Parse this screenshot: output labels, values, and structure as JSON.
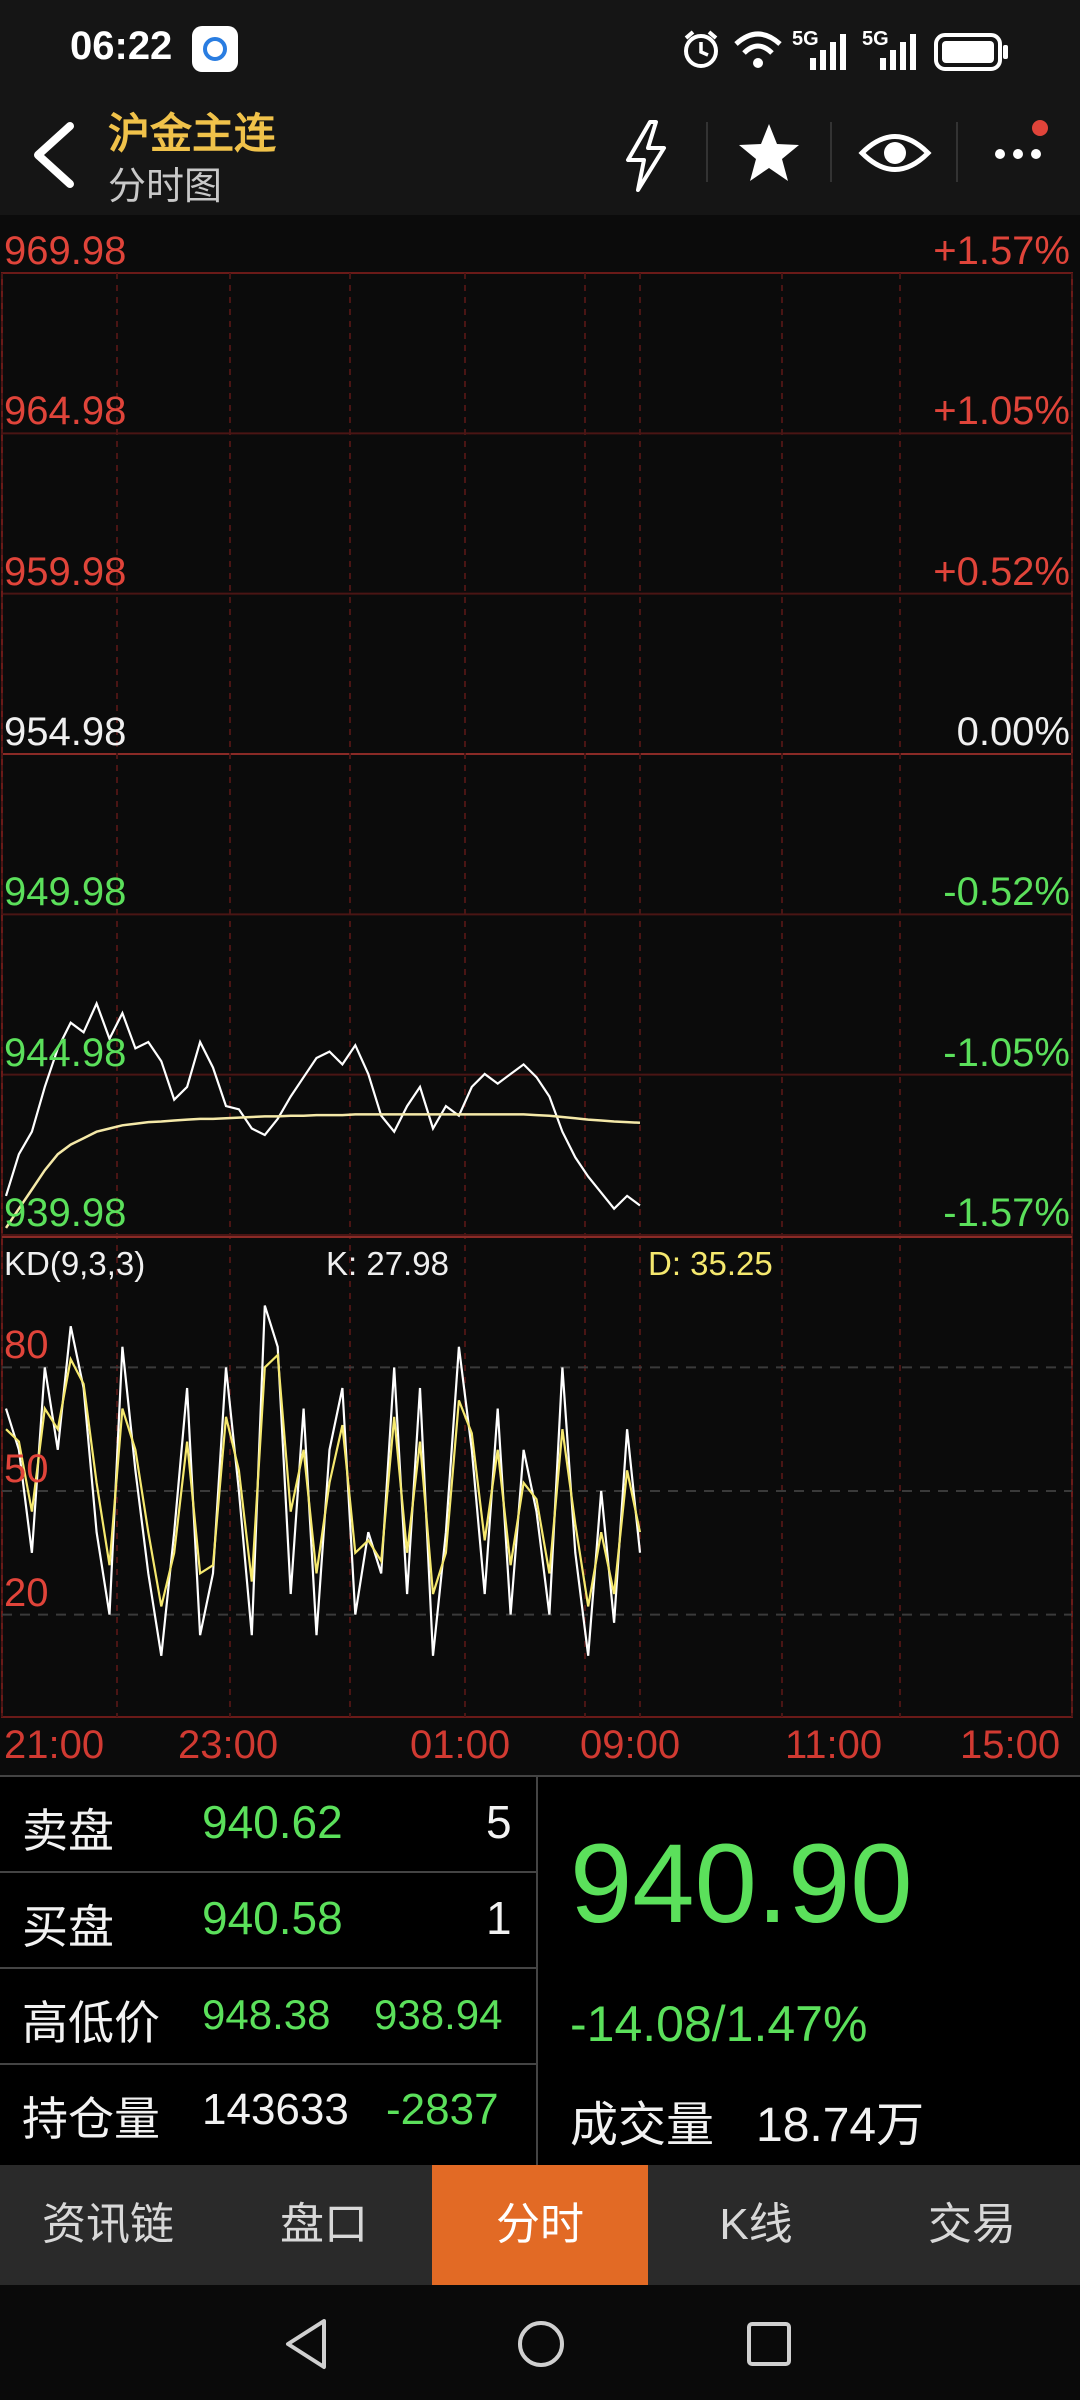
{
  "status": {
    "time": "06:22",
    "net1": "5G",
    "net2": "5G"
  },
  "header": {
    "title": "沪金主连",
    "subtitle": "分时图",
    "icons": [
      "back-arrow-icon",
      "lightning-icon",
      "star-icon",
      "eye-icon",
      "more-icon"
    ]
  },
  "chart_data": {
    "type": "line",
    "price_axis": {
      "left_labels": [
        "969.98",
        "964.98",
        "959.98",
        "954.98",
        "949.98",
        "944.98",
        "939.98"
      ],
      "right_labels": [
        "+1.57%",
        "+1.05%",
        "+0.52%",
        "0.00%",
        "-0.52%",
        "-1.05%",
        "-1.57%"
      ],
      "ylim": [
        939.98,
        969.98
      ],
      "reference": 954.98
    },
    "x_labels": [
      "21:00",
      "23:00",
      "01:00",
      "09:00",
      "11:00",
      "15:00"
    ],
    "series": [
      {
        "color": "#ffffff",
        "values": [
          941.2,
          942.5,
          943.2,
          944.6,
          945.8,
          946.6,
          946.3,
          947.2,
          946.1,
          946.9,
          945.8,
          946.0,
          945.4,
          944.2,
          944.6,
          946.0,
          945.2,
          944.0,
          943.9,
          943.3,
          943.1,
          943.6,
          944.3,
          944.9,
          945.5,
          945.7,
          945.3,
          945.9,
          945.0,
          943.7,
          943.2,
          944.0,
          944.6,
          943.3,
          944.0,
          943.7,
          944.6,
          945.0,
          944.7,
          945.0,
          945.3,
          944.9,
          944.3,
          943.2,
          942.4,
          941.8,
          941.3,
          940.8,
          941.2,
          940.9
        ]
      },
      {
        "color": "#f5e9a8",
        "values": [
          940.2,
          940.8,
          941.4,
          942.0,
          942.5,
          942.8,
          943.0,
          943.2,
          943.3,
          943.4,
          943.45,
          943.5,
          943.52,
          943.55,
          943.58,
          943.6,
          943.6,
          943.62,
          943.64,
          943.66,
          943.68,
          943.68,
          943.7,
          943.7,
          943.72,
          943.72,
          943.72,
          943.74,
          943.74,
          943.74,
          943.74,
          943.74,
          943.74,
          943.74,
          943.74,
          943.74,
          943.74,
          943.74,
          943.74,
          943.74,
          943.74,
          943.72,
          943.7,
          943.66,
          943.62,
          943.58,
          943.55,
          943.52,
          943.5,
          943.48
        ]
      }
    ]
  },
  "kd_data": {
    "type": "line",
    "title": "KD(9,3,3)",
    "k_label": "K: 27.98",
    "d_label": "D: 35.25",
    "y_labels": [
      "80",
      "50",
      "20"
    ],
    "ylim": [
      0,
      100
    ],
    "series": [
      {
        "color": "#ffffff",
        "values": [
          70,
          60,
          35,
          80,
          60,
          90,
          75,
          40,
          20,
          85,
          55,
          30,
          10,
          40,
          75,
          15,
          30,
          80,
          50,
          15,
          95,
          85,
          25,
          70,
          15,
          60,
          75,
          20,
          40,
          30,
          80,
          25,
          75,
          10,
          40,
          85,
          60,
          25,
          70,
          20,
          60,
          45,
          20,
          80,
          35,
          10,
          50,
          18,
          65,
          35
        ]
      },
      {
        "color": "#f5e86e",
        "values": [
          65,
          62,
          45,
          70,
          65,
          82,
          76,
          52,
          32,
          70,
          60,
          40,
          22,
          35,
          62,
          30,
          32,
          68,
          55,
          28,
          80,
          83,
          45,
          60,
          30,
          52,
          66,
          35,
          38,
          33,
          68,
          35,
          62,
          25,
          35,
          72,
          64,
          38,
          60,
          32,
          52,
          48,
          30,
          65,
          42,
          22,
          40,
          25,
          55,
          40
        ]
      }
    ]
  },
  "quote": {
    "sell_label": "卖盘",
    "sell_price": "940.62",
    "sell_qty": "5",
    "buy_label": "买盘",
    "buy_price": "940.58",
    "buy_qty": "1",
    "hilo_label": "高低价",
    "high": "948.38",
    "low": "938.94",
    "oi_label": "持仓量",
    "oi": "143633",
    "oi_change": "-2837",
    "last_price": "940.90",
    "change": "-14.08/1.47%",
    "volume_label": "成交量",
    "volume": "18.74万"
  },
  "tabs": [
    "资讯链",
    "盘口",
    "分时",
    "K线",
    "交易"
  ],
  "active_tab": "分时"
}
